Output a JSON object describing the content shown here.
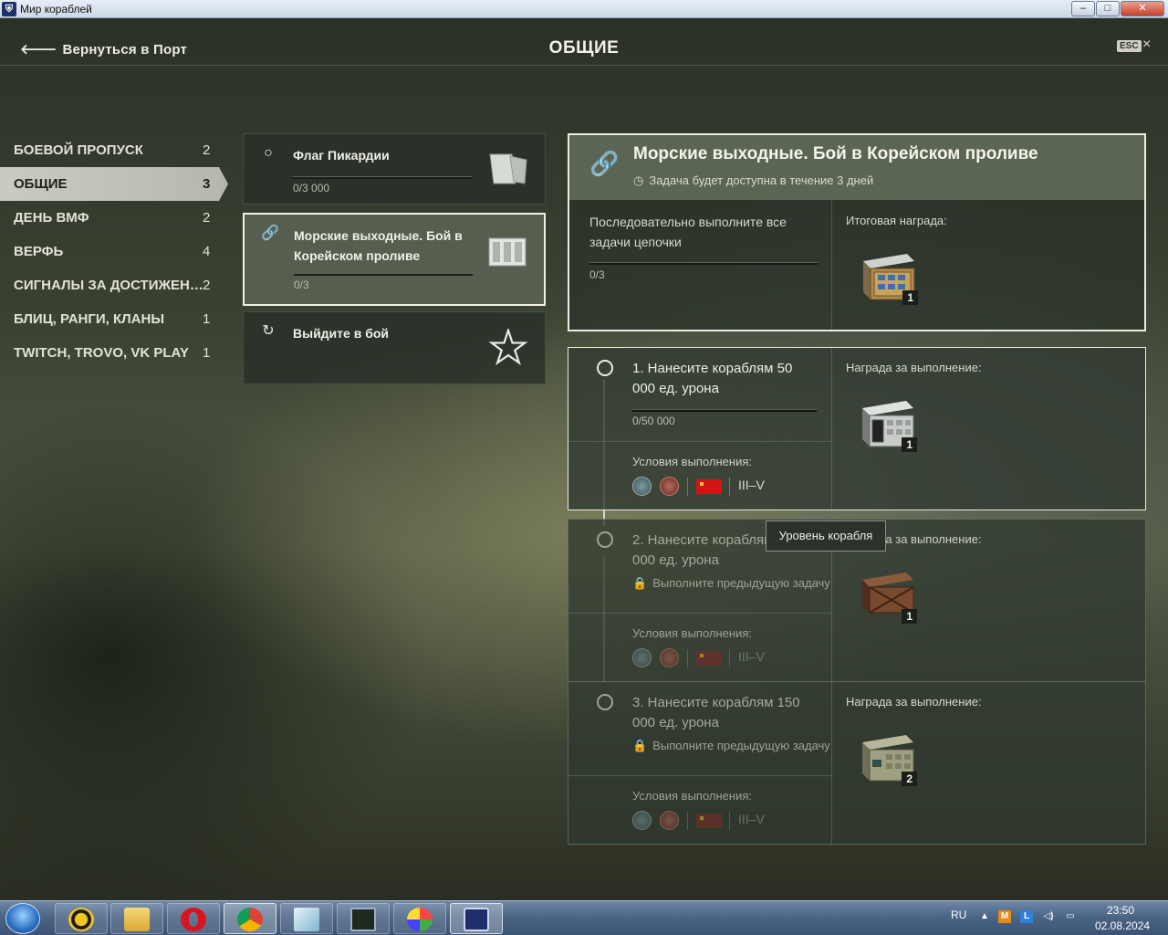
{
  "window": {
    "title": "Мир кораблей",
    "controls": {
      "minimize": "–",
      "maximize": "□",
      "close": "✕"
    }
  },
  "header": {
    "back_label": "Вернуться в Порт",
    "title": "ОБЩИЕ",
    "esc_label": "ESC",
    "close_icon": "×"
  },
  "categories": [
    {
      "label": "БОЕВОЙ ПРОПУСК",
      "count": "2",
      "active": false
    },
    {
      "label": "ОБЩИЕ",
      "count": "3",
      "active": true
    },
    {
      "label": "ДЕНЬ ВМФ",
      "count": "2",
      "active": false
    },
    {
      "label": "ВЕРФЬ",
      "count": "4",
      "active": false
    },
    {
      "label": "СИГНАЛЫ ЗА ДОСТИЖЕН…",
      "count": "2",
      "active": false
    },
    {
      "label": "БЛИЦ, РАНГИ, КЛАНЫ",
      "count": "1",
      "active": false
    },
    {
      "label": "TWITCH, TROVO, VK PLAY",
      "count": "1",
      "active": false
    }
  ],
  "quests": [
    {
      "title": "Флаг Пикардии",
      "progress": "0/3 000",
      "icon": "circle-icon",
      "art": "flag-icon"
    },
    {
      "title": "Морские выходные. Бой в Корейском проливе",
      "progress": "0/3",
      "icon": "link-icon",
      "art": "supply-crate-icon",
      "selected": true
    },
    {
      "title": "Выйдите в бой",
      "progress": "",
      "icon": "refresh-icon",
      "art": "star-icon"
    }
  ],
  "chain": {
    "title": "Морские выходные. Бой в Корейском проливе",
    "availability": "Задача будет доступна в течение 3 дней",
    "description": "Последовательно выполните все задачи цепочки",
    "progress": "0/3",
    "reward_label": "Итоговая награда:",
    "reward_count": "1"
  },
  "tasks": [
    {
      "text": "1. Нанесите кораблям 50 000 ед. урона",
      "progress": "0/50 000",
      "lock_text": "",
      "conditions_label": "Условия выполнения:",
      "tiers": "III–V",
      "reward_label": "Награда за выполнение:",
      "reward_count": "1",
      "locked": false
    },
    {
      "text": "2. Нанесите кораблям 100 000 ед. урона",
      "progress": "",
      "lock_text": "Выполните предыдущую задачу",
      "conditions_label": "Условия выполнения:",
      "tiers": "III–V",
      "reward_label": "Награда за выполнение:",
      "reward_count": "1",
      "locked": true
    },
    {
      "text": "3. Нанесите кораблям 150 000 ед. урона",
      "progress": "",
      "lock_text": "Выполните предыдущую задачу",
      "conditions_label": "Условия выполнения:",
      "tiers": "III–V",
      "reward_label": "Награда за выполнение:",
      "reward_count": "2",
      "locked": true
    }
  ],
  "tooltip": {
    "text": "Уровень корабля"
  },
  "taskbar": {
    "apps": [
      "aimp-icon",
      "explorer-icon",
      "opera-icon",
      "chrome-icon",
      "notepad-icon",
      "task-manager-icon",
      "paint-icon",
      "mir-korabley-icon"
    ],
    "lang": "RU",
    "time": "23:50",
    "date": "02.08.2024"
  },
  "colors": {
    "accent": "#ecece2",
    "active_category": "#d5d5cb",
    "ussr_red": "#d21414",
    "taskbar": "#4c6585"
  }
}
